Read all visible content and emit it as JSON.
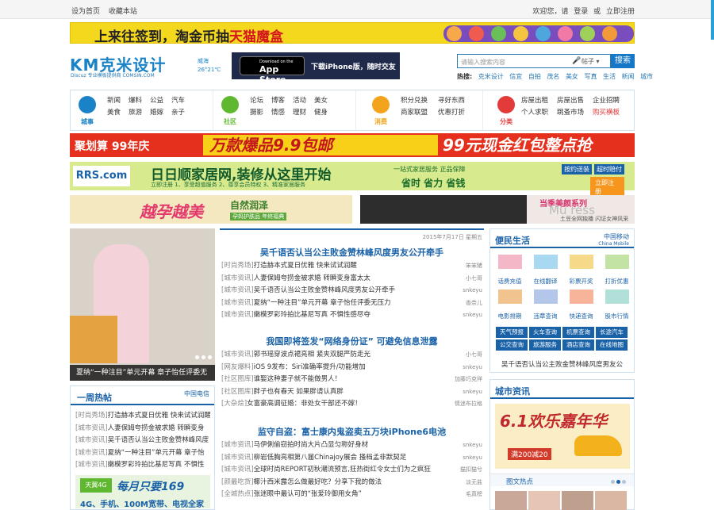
{
  "topbar": {
    "left": [
      "设为首页",
      "收藏本站"
    ],
    "right": [
      "欢迎您，请",
      "登录",
      "或",
      "立即注册"
    ]
  },
  "ad_top": {
    "prefix": "上来往签到，淘金币抽",
    "highlight": "天猫魔盒"
  },
  "logo": {
    "main": "KM克米设计",
    "sub": "Discuz 专业模板提供商   COMSIN.COM"
  },
  "weather": {
    "city": "威海",
    "temp": "26°21℃"
  },
  "appstore": {
    "small": "Download on the",
    "big": "App Store",
    "slogan": "下载iPhone版，随时交友"
  },
  "search": {
    "placeholder": "请输入搜索内容",
    "select": "帖子",
    "button": "搜索"
  },
  "hot": {
    "label": "热搜:",
    "items": [
      "克米设计",
      "信宜",
      "自拍",
      "茂名",
      "美女",
      "写真",
      "生活",
      "新闻",
      "城市"
    ]
  },
  "nav": {
    "groups": [
      {
        "label": "城事",
        "color": "#1a82c7",
        "links": [
          "新闻",
          "爆料",
          "公益",
          "汽车",
          "美食",
          "旅游",
          "婚嫁",
          "亲子"
        ]
      },
      {
        "label": "社区",
        "color": "#5fb830",
        "links": [
          "论坛",
          "博客",
          "活动",
          "美女",
          "摄影",
          "情感",
          "理财",
          "健身"
        ]
      },
      {
        "label": "消费",
        "color": "#f3a41c",
        "links": [
          "积分兑换",
          "寻好东西",
          "商家联盟",
          "优惠打折"
        ]
      },
      {
        "label": "分类",
        "color": "#e33a3a",
        "links": [
          "房屋出租",
          "房屋出售",
          "企业招聘",
          "个人求职",
          "跳蚤市场",
          "购买横板"
        ]
      }
    ]
  },
  "ad_bar": {
    "a": "聚划算 99年庆",
    "b": "万款爆品9.9包邮",
    "c": "99元现金红包整点抢"
  },
  "ad_rrs": {
    "logo": "RRS.com",
    "title": "日日顺家居网,装修从这里开始",
    "sub": "立即注册  1、享受超值服务  2、尊享会员特权  3、精准家居服务",
    "t3": "一站式家居服务 正品保障",
    "t4": "省时 省力 省钱",
    "btn1": "按约送装",
    "btn2": "超时赔付",
    "go": "立即注册"
  },
  "ad_left": {
    "title": "越孕越美",
    "t2": "自然润泽",
    "t3": "孕妈护肤品 年终福典"
  },
  "ad_right": {
    "a": "当季美颜系列",
    "b": "Mu ress",
    "c": "土豆全网独播 闪证女神风采"
  },
  "photo": {
    "caption": "夏纳“一种注目”单元开幕 章子怡任评委无"
  },
  "week_hot": {
    "title": "一周热帖",
    "sponsor": "中国电信",
    "items": [
      {
        "cat": "[时尚秀场]",
        "title": "打造赫本式夏日优雅 快来试试润醒"
      },
      {
        "cat": "[城市资讯]",
        "title": "人妻保姆夸捞金被求婚 转瞬变身"
      },
      {
        "cat": "[城市资讯]",
        "title": "吴千语否认当公主败金赞林峰风度"
      },
      {
        "cat": "[城市资讯]",
        "title": "夏纳“一种注目”单元开幕 章子怡"
      },
      {
        "cat": "[城市资讯]",
        "title": "嫩模罗彩玲拍比基尼写真 不惧性"
      }
    ],
    "ad": {
      "logo": "天翼4G",
      "t": "每月只要169",
      "t2": "4G、手机、100M宽带、电视全家有"
    }
  },
  "center": {
    "date": "2015年7月17日 星期五",
    "sections": [
      {
        "headline": "吴千语否认当公主败金赞林峰风度男友公开牵手",
        "items": [
          {
            "cat": "[时尚秀场]",
            "title": "打造赫本式夏日优雅 快来试试润醒",
            "au": "笨笨猪"
          },
          {
            "cat": "[城市资讯]",
            "title": "人妻保姆夸捞金被求婚 转瞬变身富太太",
            "au": "小七哥"
          },
          {
            "cat": "[城市资讯]",
            "title": "吴千语否认当公主败金赞林峰风度男友公开牵手",
            "au": "snkeyu"
          },
          {
            "cat": "[城市资讯]",
            "title": "夏纳“一种注目”单元开幕 章子怡任评委无压力",
            "au": "香奈儿"
          },
          {
            "cat": "[城市资讯]",
            "title": "嫩模罗彩玲拍比基尼写真 不惧性感尽夺",
            "au": "snkeyu"
          }
        ]
      },
      {
        "headline": "我国即将签发“网络身份证” 可避免信息泄露",
        "items": [
          {
            "cat": "[城市资讯]",
            "title": "郭书瑶穿波点裙亮相 紧夹双腿严防走光",
            "au": "小七哥"
          },
          {
            "cat": "[网友爆料]",
            "title": "iOS 9发布：Siri准确率提升/功能增加",
            "au": "snkeyu"
          },
          {
            "cat": "[社区图库]",
            "title": "谁娶这种妻子就不能做男人！",
            "au": "加藤巧克祥"
          },
          {
            "cat": "[社区图库]",
            "title": "胖子也有春天 如果胖请认真胖",
            "au": "snkeyu"
          },
          {
            "cat": "[大杂烩]",
            "title": "女富豪高调征婚：非处女干部还不嫁！",
            "au": "情迷布拉格"
          }
        ]
      },
      {
        "headline": "监守自盗：富士康内鬼盗卖五万块iPhone6电池",
        "items": [
          {
            "cat": "[城市资讯]",
            "title": "马伊俐偷窃拍时尚大片凸显匀称好身材",
            "au": "snkeyu"
          },
          {
            "cat": "[城市资讯]",
            "title": "柳岩低胸亮相第八届Chinajoy展会 搔档孟非默契足",
            "au": "snkeyu"
          },
          {
            "cat": "[城市资讯]",
            "title": "全球时尚REPORT初秋潮流预言,狂热街红令女士们为之疯狂",
            "au": "猫扣猫兮"
          },
          {
            "cat": "[颜最吃货]",
            "title": "椰汁西米露怎么做最好吃？分享下我的做法",
            "au": "淡无盐"
          },
          {
            "cat": "[全城热点]",
            "title": "张迷眼中最认可的“张爱玲御用女角”",
            "au": "毛真榜"
          }
        ]
      }
    ]
  },
  "life": {
    "title": "便民生活",
    "sponsor": "中国移动",
    "sponsor_en": "China Mobile",
    "services": [
      "话费充值",
      "在线翻译",
      "彩票开奖",
      "打折优惠",
      "电影排期",
      "违章查询",
      "快递查询",
      "股市行情"
    ],
    "blue": [
      "天气预报",
      "火车查询",
      "机票查询",
      "长途汽车",
      "公交查询",
      "旅游服务",
      "酒店查询",
      "在线地图"
    ],
    "bottom": "吴千语否认当公主败金赞林峰风度男友公"
  },
  "city": {
    "title": "城市资讯",
    "ad": {
      "t": "6.1欢乐嘉年华",
      "t2": "满200减20"
    },
    "pics": "图文热点"
  }
}
